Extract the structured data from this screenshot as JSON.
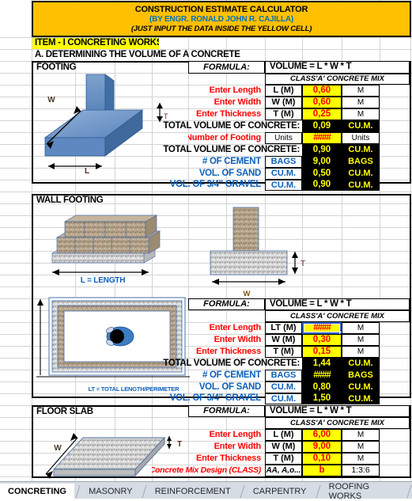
{
  "banner": {
    "line1": "CONSTRUCTION ESTIMATE CALCULATOR",
    "line2": "(BY ENGR. RONALD JOHN R. CAJILLA)",
    "line3": "(JUST INPUT THE DATA INSIDE THE YELLOW CELL)",
    "bg_color": "#ffc000",
    "line2_color": "#0070c0"
  },
  "item_header": "ITEM - I CONCRETING WORKS",
  "section_a": "A. DETERMINING THE VOLUME OF A CONCRETE",
  "labels": {
    "formula": "FORMULA:",
    "volume_formula": "VOLUME = L * W * T",
    "class_mix": "CLASS'A' CONCRETE MIX",
    "enter_length": "Enter Length",
    "enter_width": "Enter Width",
    "enter_thickness": "Enter Thickness",
    "total_volume": "TOTAL VOLUME OF CONCRETE:",
    "number_of_footing": "Number of Footing",
    "cement": "# OF CEMENT",
    "sand": "VOL. OF SAND",
    "gravel": "VOL. OF 3/4\" GRAVEL",
    "mix_design": "Concrete Mix Design  (CLASS)",
    "lt_note": "LT = TOTAL  LENGTH/PERIMETER",
    "l_dim": "L",
    "w_dim": "W",
    "t_dim": "T",
    "l_length": "L = LENGTH"
  },
  "units": {
    "m": "M",
    "cum": "CU.M.",
    "bags": "BAGS",
    "units": "Units",
    "overflow": "####"
  },
  "sections": [
    {
      "title": "FOOTING",
      "rows": [
        {
          "label": "Enter Length",
          "sym": "L (M)",
          "value": "0,60",
          "unit": "M"
        },
        {
          "label": "Enter Width",
          "sym": "W (M)",
          "value": "0,60",
          "unit": "M"
        },
        {
          "label": "Enter Thickness",
          "sym": "T (M)",
          "value": "0,25",
          "unit": "M"
        }
      ],
      "total1": {
        "label": "TOTAL VOLUME OF CONCRETE:",
        "value": "0,09",
        "unit": "CU.M."
      },
      "count": {
        "label": "Number of Footing",
        "sym": "Units",
        "value": "####",
        "unit": "Units"
      },
      "total2": {
        "label": "TOTAL VOLUME OF CONCRETE:",
        "value": "0,90",
        "unit": "CU.M."
      },
      "materials": [
        {
          "label": "# OF CEMENT",
          "sym": "BAGS",
          "value": "9,00",
          "unit": "BAGS"
        },
        {
          "label": "VOL. OF SAND",
          "sym": "CU.M.",
          "value": "0,50",
          "unit": "CU.M."
        },
        {
          "label": "VOL. OF 3/4\" GRAVEL",
          "sym": "CU.M.",
          "value": "0,90",
          "unit": "CU.M."
        }
      ]
    },
    {
      "title": "WALL FOOTING",
      "rows": [
        {
          "label": "Enter Length",
          "sym": "LT (M)",
          "value": "####",
          "unit": "M"
        },
        {
          "label": "Enter Width",
          "sym": "W (M)",
          "value": "0,30",
          "unit": "M"
        },
        {
          "label": "Enter Thickness",
          "sym": "T (M)",
          "value": "0,15",
          "unit": "M"
        }
      ],
      "total1": {
        "label": "TOTAL VOLUME OF CONCRETE:",
        "value": "1,44",
        "unit": "CU.M."
      },
      "materials": [
        {
          "label": "# OF CEMENT",
          "sym": "BAGS",
          "value": "####",
          "unit": "BAGS"
        },
        {
          "label": "VOL. OF SAND",
          "sym": "CU.M.",
          "value": "0,80",
          "unit": "CU.M."
        },
        {
          "label": "VOL. OF 3/4\" GRAVEL",
          "sym": "CU.M.",
          "value": "1,50",
          "unit": "CU.M."
        }
      ]
    },
    {
      "title": "FLOOR SLAB",
      "rows": [
        {
          "label": "Enter Length",
          "sym": "L (M)",
          "value": "6,00",
          "unit": "M"
        },
        {
          "label": "Enter Width",
          "sym": "W (M)",
          "value": "9,00",
          "unit": "M"
        },
        {
          "label": "Enter Thickness",
          "sym": "T (M)",
          "value": "0,10",
          "unit": "M"
        }
      ],
      "mix": {
        "label": "Concrete Mix Design  (CLASS)",
        "sym": "AA, A,o...",
        "value": "b",
        "ratio": "1:3:6"
      }
    }
  ],
  "tabs": [
    {
      "label": "CONCRETING",
      "active": true
    },
    {
      "label": "MASONRY",
      "active": false
    },
    {
      "label": "REINFORCEMENT",
      "active": false
    },
    {
      "label": "CARPENTRY",
      "active": false
    },
    {
      "label": "ROOFING WORKS",
      "active": false
    }
  ],
  "colors": {
    "header_orange": "#ffc000",
    "input_yellow": "#ffff00",
    "label_red": "#ff0000",
    "material_blue": "#0b5fba",
    "total_black": "#000000",
    "total_text": "#ffff00"
  }
}
